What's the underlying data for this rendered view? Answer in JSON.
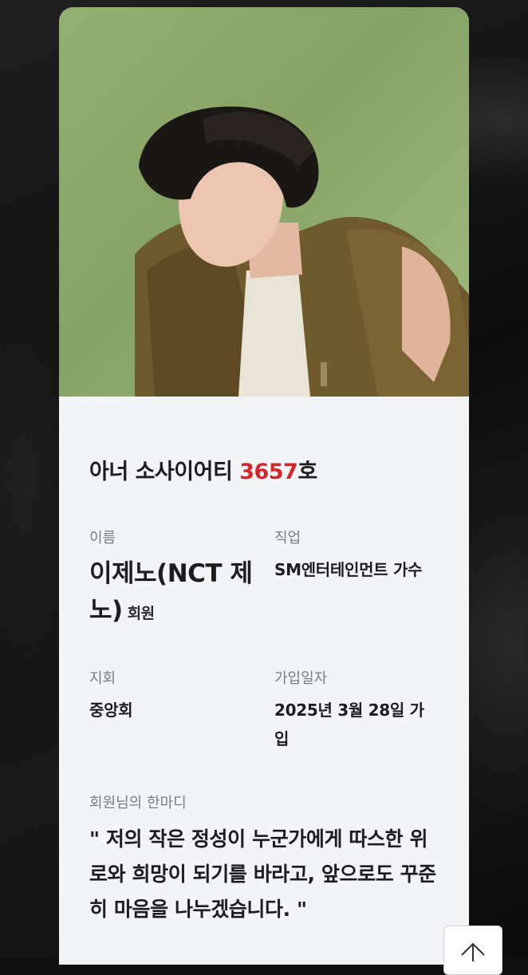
{
  "card": {
    "photo_alt": "member-photo",
    "society_prefix": "아너 소사이어티 ",
    "society_number": "3657",
    "society_suffix": "호",
    "name_label": "이름",
    "name_value": "이제노(NCT 제노)",
    "name_suffix": "회원",
    "job_label": "직업",
    "job_value": "SM엔터테인먼트 가수",
    "branch_label": "지회",
    "branch_value": "중앙회",
    "join_label": "가입일자",
    "join_value": "2025년 3월 28일 가입",
    "quote_label": "회원님의 한마디",
    "quote_text": "\" 저의 작은 정성이 누군가에게 따스한 위로와 희망이 되기를 바라고, 앞으로도 꾸준히 마음을 나누겠습니다. \""
  },
  "scroll_top_button": {
    "icon": "arrow-up-icon"
  },
  "colors": {
    "accent_number": "#d3262a",
    "card_bg": "#f3f4f6",
    "photo_bg": "#8fad6c"
  }
}
